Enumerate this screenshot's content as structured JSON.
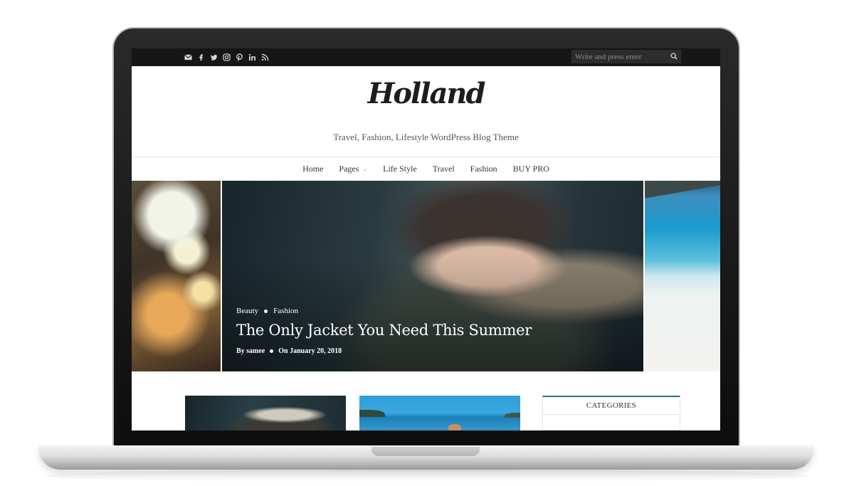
{
  "topbar": {
    "social_icons": [
      "envelope-icon",
      "facebook-icon",
      "twitter-icon",
      "instagram-icon",
      "pinterest-icon",
      "linkedin-icon",
      "rss-icon"
    ],
    "search": {
      "placeholder": "Write and press enter"
    }
  },
  "header": {
    "logo": "Holland",
    "tagline": "Travel, Fashion, Lifestyle WordPress Blog Theme"
  },
  "nav": {
    "items": [
      {
        "label": "Home"
      },
      {
        "label": "Pages",
        "has_dropdown": true
      },
      {
        "label": "Life Style"
      },
      {
        "label": "Travel"
      },
      {
        "label": "Fashion"
      },
      {
        "label": "BUY PRO"
      }
    ]
  },
  "slider": {
    "featured": {
      "categories": [
        "Beauty",
        "Fashion"
      ],
      "title": "The Only Jacket You Need This Summer",
      "author": "By samee",
      "date": "On January 20, 2018"
    }
  },
  "sidebar": {
    "widget_title": "CATEGORIES"
  },
  "colors": {
    "topbar_bg": "#161616",
    "accent": "#2b6f87",
    "text_dark": "#333333"
  }
}
